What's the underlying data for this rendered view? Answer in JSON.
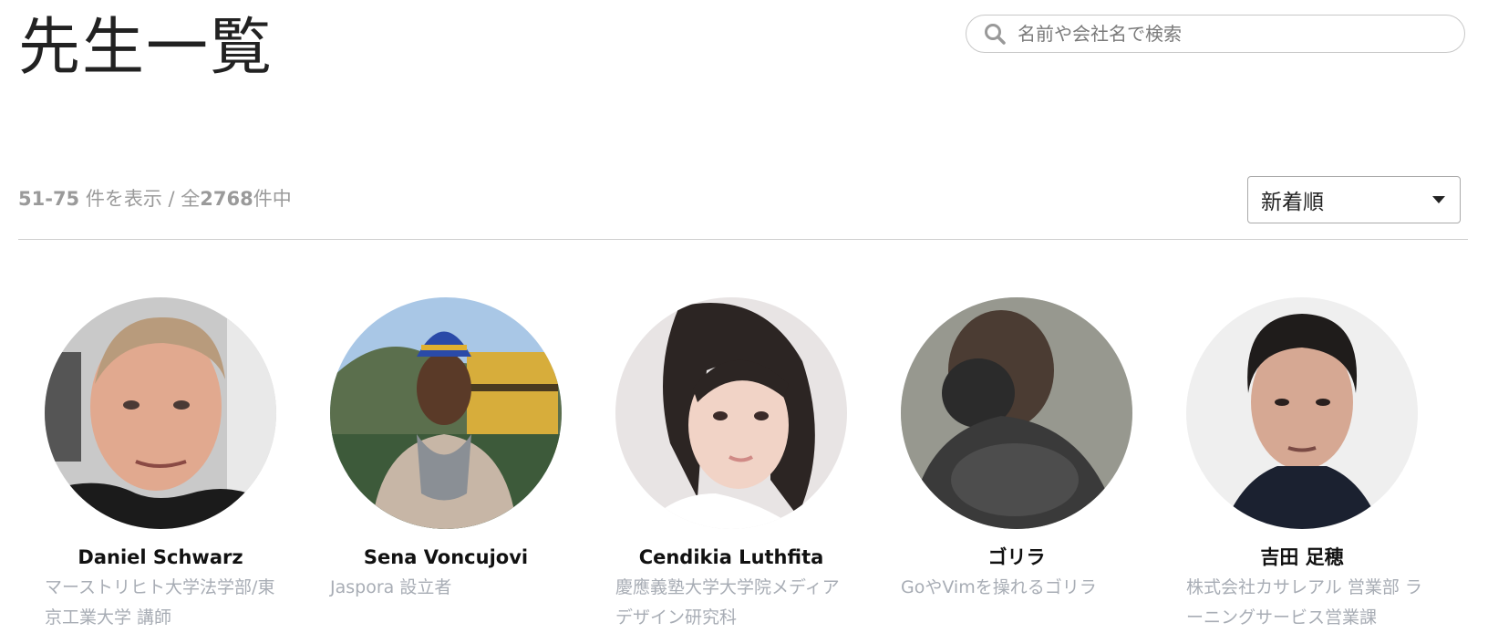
{
  "page": {
    "title": "先生一覧"
  },
  "search": {
    "placeholder": "名前や会社名で検索",
    "value": ""
  },
  "results": {
    "range": "51-75",
    "range_suffix": " 件を表示 / 全",
    "total": "2768",
    "total_suffix": "件中"
  },
  "sort": {
    "selected": "新着順"
  },
  "teachers": [
    {
      "name": "Daniel Schwarz",
      "title": "マーストリヒト大学法学部/東京工業大学 講師",
      "avatar_icon": "person-photo"
    },
    {
      "name": "Sena Voncujovi",
      "title": "Jaspora 設立者",
      "avatar_icon": "person-photo"
    },
    {
      "name": "Cendikia Luthfita",
      "title": "慶應義塾大学大学院メディアデザイン研究科",
      "avatar_icon": "person-photo"
    },
    {
      "name": "ゴリラ",
      "title": "GoやVimを操れるゴリラ",
      "avatar_icon": "gorilla-photo"
    },
    {
      "name": "吉田 足穂",
      "title": "株式会社カサレアル 営業部 ラーニングサービス営業課",
      "avatar_icon": "person-photo"
    }
  ],
  "colors": {
    "muted_text": "#9a9a9a",
    "subtitle_text": "#a8adb5",
    "divider": "#d0d0d0"
  }
}
